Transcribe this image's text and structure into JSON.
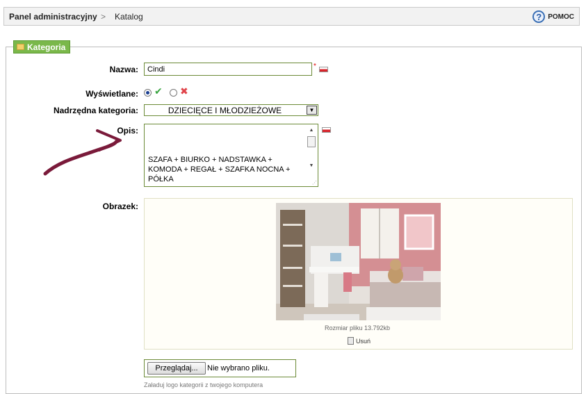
{
  "breadcrumb": {
    "home": "Panel administracyjny",
    "separator": ">",
    "current": "Katalog"
  },
  "help": {
    "label": "POMOC",
    "icon": "help-icon"
  },
  "section": {
    "legend": "Kategoria",
    "icon": "folder-icon"
  },
  "fields": {
    "name": {
      "label": "Nazwa:",
      "value": "Cindi",
      "required_mark": "*"
    },
    "visible": {
      "label": "Wyświetlane:",
      "yes_icon": "check-icon",
      "no_icon": "x-icon",
      "selected": "yes"
    },
    "parent": {
      "label": "Nadrzędna kategoria:",
      "value": "DZIECIĘCE I MŁODZIEŻOWE"
    },
    "description": {
      "label": "Opis:",
      "value": "SZAFA + BIURKO + NADSTAWKA + KOMODA + REGAŁ + SZAFKA NOCNA + PÓŁKA"
    },
    "image": {
      "label": "Obrazek:",
      "file_size": "Rozmiar pliku 13.792kb",
      "remove_label": "Usuń"
    },
    "upload": {
      "browse_label": "Przeglądaj...",
      "status": "Nie wybrano pliku.",
      "hint": "Załaduj logo kategorii z twojego komputera"
    }
  },
  "colors": {
    "accent": "#7ab84a",
    "arrow": "#7a1a3a",
    "input_border": "#6b8a36"
  }
}
